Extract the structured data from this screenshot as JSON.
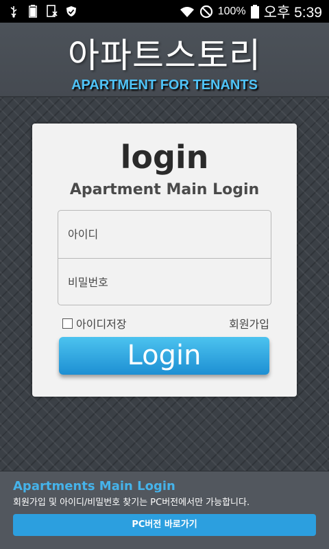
{
  "status_bar": {
    "battery_percent": "100%",
    "clock": "오후 5:39",
    "icons": [
      "usb-icon",
      "battery-full-icon",
      "notification-icon",
      "shield-icon",
      "wifi-icon",
      "do-not-disturb-icon",
      "battery-icon"
    ]
  },
  "header": {
    "title": "아파트스토리",
    "subtitle": "APARTMENT FOR TENANTS"
  },
  "login": {
    "heading": "login",
    "subheading": "Apartment Main Login",
    "id_placeholder": "아이디",
    "password_placeholder": "비밀번호",
    "save_id_label": "아이디저장",
    "signup_label": "회원가입",
    "login_button_label": "Login"
  },
  "bottom_panel": {
    "title": "Apartments Main Login",
    "note": "회원가입 및 아이디/비밀번호 찾기는 PC버전에서만 가능합니다.",
    "pc_button_label": "PC버전 바로가기"
  },
  "colors": {
    "accent_blue": "#2c9fdf",
    "subtitle_blue": "#4fc3f7",
    "header_bg": "#4c5259"
  }
}
